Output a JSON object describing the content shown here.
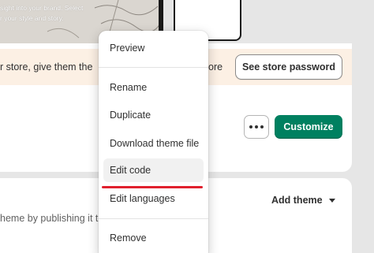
{
  "preview": {
    "sketch_text": "sight into your brand. Select\nr your style and story."
  },
  "banner": {
    "text": "r store, give them the",
    "text_tail": "ore",
    "button_label": "See store password"
  },
  "current_theme": {
    "customize_label": "Customize",
    "more_actions_label": "More actions"
  },
  "library": {
    "description": "heme by publishing it to",
    "add_theme_label": "Add theme"
  },
  "menu": {
    "items": [
      {
        "label": "Preview"
      },
      {
        "label": "Rename"
      },
      {
        "label": "Duplicate"
      },
      {
        "label": "Download theme file"
      },
      {
        "label": "Edit code",
        "hovered": true
      },
      {
        "label": "Edit languages"
      },
      {
        "label": "Remove"
      }
    ]
  },
  "colors": {
    "primary": "#008060",
    "banner_bg": "#fcf0e4",
    "annotation_underline": "#e0202e"
  }
}
